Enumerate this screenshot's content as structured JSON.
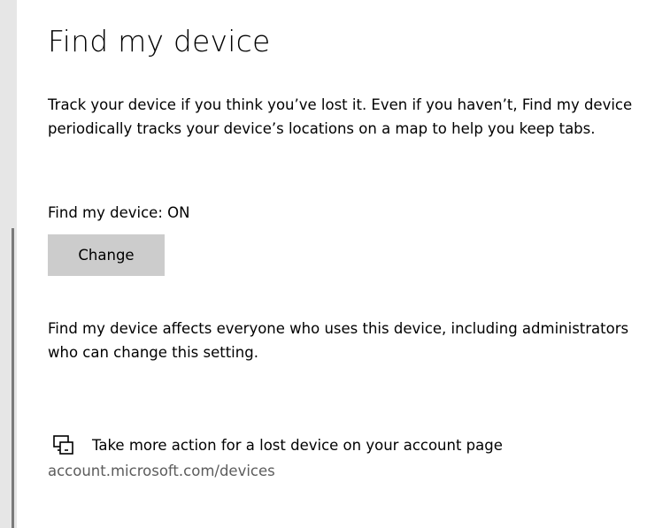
{
  "page": {
    "title": "Find my device",
    "description": "Track your device if you think you’ve lost it. Even if you haven’t, Find my device periodically tracks your device’s locations on a map to help you keep tabs.",
    "status_label": "Find my device: ON",
    "change_button_label": "Change",
    "affects_note": "Find my device affects everyone who uses this device, including administrators who can change this setting.",
    "lost_device_action": "Take more action for a lost device on your account page",
    "account_link": "account.microsoft.com/devices"
  },
  "icons": {
    "lost_device_icon": "devices-icon"
  },
  "colors": {
    "button_bg": "#cccccc",
    "link_text": "#5c5c5c",
    "left_strip": "#e6e6e6",
    "scrollbar": "#7a7a7a"
  }
}
